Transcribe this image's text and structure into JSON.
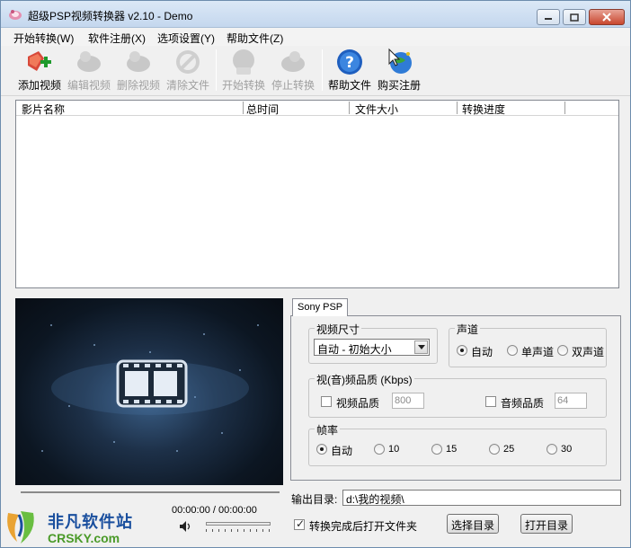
{
  "window": {
    "title": "超级PSP视频转换器 v2.10 - Demo"
  },
  "menu": [
    {
      "label": "开始转换(W)"
    },
    {
      "label": "软件注册(X)"
    },
    {
      "label": "选项设置(Y)"
    },
    {
      "label": "帮助文件(Z)"
    }
  ],
  "toolbar": {
    "add_video": "添加视频",
    "edit_video": "编辑视频",
    "delete_video": "删除视频",
    "clear_files": "清除文件",
    "start_convert": "开始转换",
    "stop_convert": "停止转换",
    "help_file": "帮助文件",
    "buy_register": "购买注册"
  },
  "file_list": {
    "columns": [
      "影片名称",
      "总时间",
      "文件大小",
      "转换进度"
    ],
    "rows": []
  },
  "player": {
    "time": "00:00:00 / 00:00:00"
  },
  "tabs": [
    {
      "label": "Sony PSP",
      "selected": true
    }
  ],
  "settings": {
    "video_size": {
      "title": "视频尺寸",
      "selected": "自动 - 初始大小"
    },
    "channel": {
      "title": "声道",
      "options": [
        "自动",
        "单声道",
        "双声道"
      ],
      "selected": "自动"
    },
    "quality": {
      "title": "视(音)频品质 (Kbps)",
      "video_label": "视频品质",
      "video_value": "800",
      "video_checked": false,
      "audio_label": "音频品质",
      "audio_value": "64",
      "audio_checked": false
    },
    "framerate": {
      "title": "帧率",
      "options": [
        "自动",
        "10",
        "15",
        "25",
        "30"
      ],
      "selected": "自动"
    }
  },
  "output": {
    "label": "输出目录:",
    "path": "d:\\我的视频\\",
    "open_after_label": "转换完成后打开文件夹",
    "open_after_checked": true,
    "select_dir_button": "选择目录",
    "open_dir_button": "打开目录"
  },
  "watermark": {
    "name": "非凡软件站",
    "domain": "CRSKY.com"
  },
  "colors": {
    "window_bg": "#f0f0f0",
    "title_bar": "#c4d7ee",
    "close_button": "#c8472e",
    "help_icon": "#1f5fbf",
    "watermark_blue": "#1a4f9e",
    "watermark_green": "#4a9a28"
  }
}
